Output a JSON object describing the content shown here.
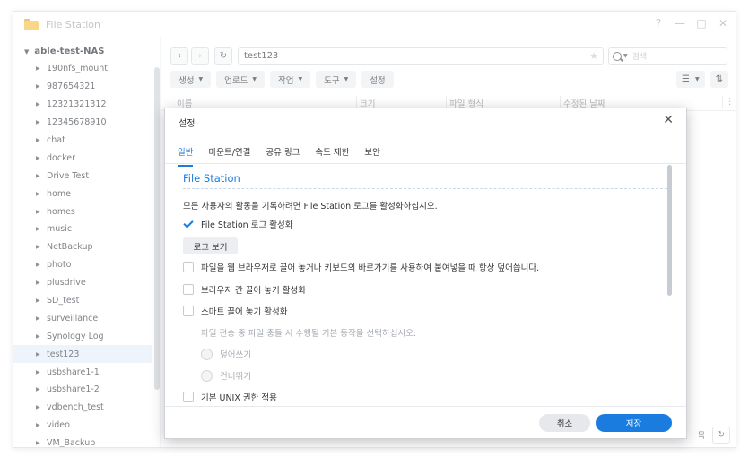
{
  "window": {
    "title": "File Station",
    "controls": [
      "?",
      "—",
      "□",
      "✕"
    ]
  },
  "sidebar": {
    "root": "able-test-NAS",
    "items": [
      {
        "label": "190nfs_mount"
      },
      {
        "label": "987654321"
      },
      {
        "label": "12321321312"
      },
      {
        "label": "12345678910"
      },
      {
        "label": "chat"
      },
      {
        "label": "docker"
      },
      {
        "label": "Drive Test"
      },
      {
        "label": "home"
      },
      {
        "label": "homes"
      },
      {
        "label": "music"
      },
      {
        "label": "NetBackup"
      },
      {
        "label": "photo"
      },
      {
        "label": "plusdrive"
      },
      {
        "label": "SD_test"
      },
      {
        "label": "surveillance"
      },
      {
        "label": "Synology Log"
      },
      {
        "label": "test123",
        "active": true
      },
      {
        "label": "usbshare1-1"
      },
      {
        "label": "usbshare1-2"
      },
      {
        "label": "vdbench_test"
      },
      {
        "label": "video"
      },
      {
        "label": "VM_Backup"
      }
    ]
  },
  "nav": {
    "back": "‹",
    "forward": "›",
    "refresh": "↻",
    "path": "test123",
    "search_placeholder": "검색"
  },
  "toolbar": {
    "create": "생성",
    "upload": "업로드",
    "action": "작업",
    "tools": "도구",
    "settings": "설정"
  },
  "columns": {
    "name": "이름",
    "size": "크기",
    "type": "파일 형식",
    "modified": "수정된 날짜"
  },
  "status": {
    "items_partial": "목"
  },
  "dialog": {
    "title": "설정",
    "tabs": [
      "일반",
      "마운트/연결",
      "공유 링크",
      "속도 제한",
      "보안"
    ],
    "section": "File Station",
    "description": "모든 사용자의 활동을 기록하려면 File Station 로그를 활성화하십시오.",
    "enable_log": "File Station 로그 활성화",
    "view_log": "로그 보기",
    "drag_paste": "파일을 웹 브라우저로 끌어 놓거나 키보드의 바로가기를 사용하여 붙여넣을 때 항상 덮어씁니다.",
    "cross_browser": "브라우저 간 끌어 놓기 활성화",
    "smart_drag": "스마트 끌어 놓기 활성화",
    "conflict_desc": "파일 전송 중 파일 충돌 시 수행될 기본 동작을 선택하십시오:",
    "overwrite": "덮어쓰기",
    "skip": "건너뛰기",
    "unix_perm": "기본 UNIX 권한 적용",
    "cancel": "취소",
    "save": "저장"
  },
  "colors": {
    "accent": "#1a7cde",
    "selected_row": "#e4eef9",
    "folder": "#f5c24a"
  }
}
